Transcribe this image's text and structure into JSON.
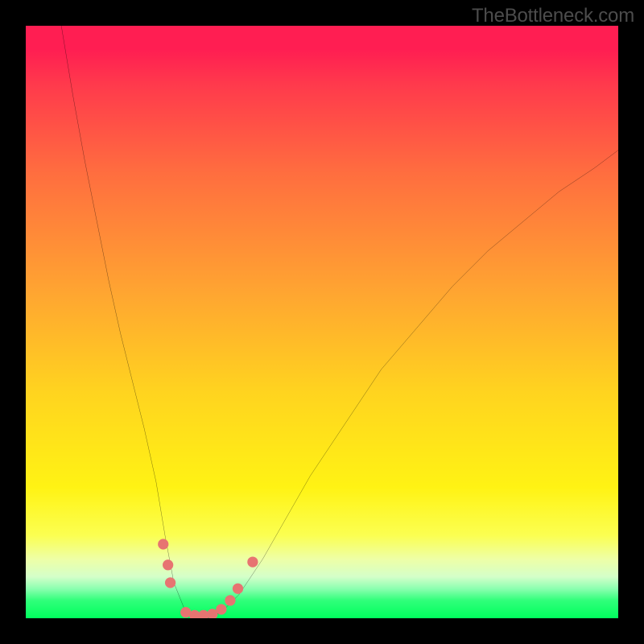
{
  "watermark": "TheBottleneck.com",
  "colors": {
    "frame": "#000000",
    "curve_stroke": "#000000",
    "dot_fill": "#e77471",
    "gradient_stops": [
      "#ff1e52",
      "#ff6e3f",
      "#ffd41f",
      "#fbff51",
      "#00ff5e"
    ]
  },
  "chart_data": {
    "type": "line",
    "title": "",
    "xlabel": "",
    "ylabel": "",
    "xlim": [
      0,
      100
    ],
    "ylim": [
      0,
      100
    ],
    "grid": false,
    "series": [
      {
        "name": "bottleneck-curve",
        "x": [
          6,
          8,
          10,
          12,
          14,
          16,
          18,
          20,
          22,
          23.5,
          25,
          27,
          29,
          31,
          33,
          36,
          40,
          44,
          48,
          54,
          60,
          66,
          72,
          78,
          84,
          90,
          96,
          100
        ],
        "y": [
          100,
          88,
          77,
          67,
          57,
          48,
          40,
          32,
          23,
          14,
          6,
          1,
          0,
          0,
          1,
          4,
          10,
          17,
          24,
          33,
          42,
          49,
          56,
          62,
          67,
          72,
          76,
          79
        ]
      }
    ],
    "dots": {
      "name": "highlight-points",
      "points": [
        {
          "x": 23.2,
          "y": 12.5
        },
        {
          "x": 24.0,
          "y": 9.0
        },
        {
          "x": 24.4,
          "y": 6.0
        },
        {
          "x": 27.0,
          "y": 1.0
        },
        {
          "x": 28.5,
          "y": 0.5
        },
        {
          "x": 30.0,
          "y": 0.5
        },
        {
          "x": 31.5,
          "y": 0.7
        },
        {
          "x": 33.0,
          "y": 1.5
        },
        {
          "x": 34.5,
          "y": 3.0
        },
        {
          "x": 35.8,
          "y": 5.0
        },
        {
          "x": 38.3,
          "y": 9.5
        }
      ]
    }
  }
}
